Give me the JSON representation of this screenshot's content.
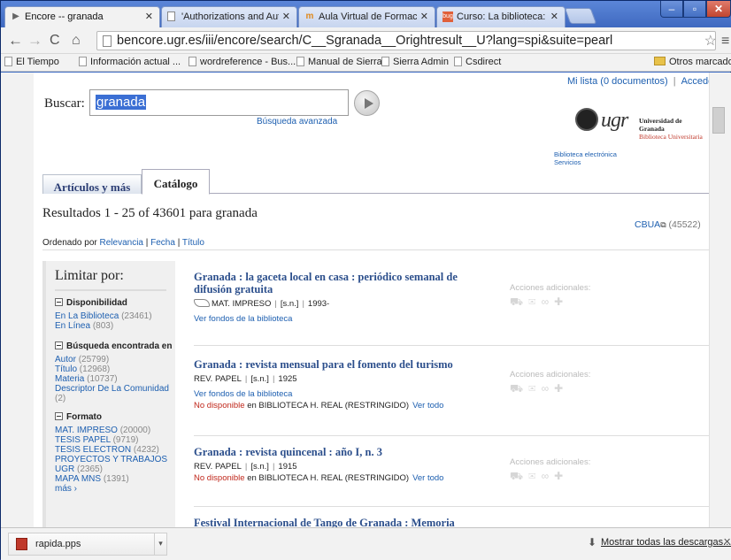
{
  "browser": {
    "tabs": [
      {
        "label": "Encore -- granada",
        "icon": "encore-icon"
      },
      {
        "label": "'Authorizations and Authe",
        "icon": "page-icon"
      },
      {
        "label": "Aula Virtual de Formación",
        "icon": "moodle-icon"
      },
      {
        "label": "Curso: La biblioteca: servic",
        "icon": "bug-icon"
      }
    ],
    "url": "bencore.ugr.es/iii/encore/search/C__Sgranada__Orightresult__U?lang=spi&suite=pearl",
    "bookmarks": [
      "El Tiempo",
      "Información actual ...",
      "wordreference - Bus...",
      "Manual de Sierra",
      "Sierra Admin",
      "Csdirect"
    ],
    "other_bookmarks": "Otros marcadores"
  },
  "page": {
    "top_links": {
      "mylist": "Mi lista (0 documentos)",
      "login": "Acceder"
    },
    "search": {
      "label": "Buscar:",
      "value": "granada",
      "advanced": "Búsqueda avanzada"
    },
    "logo": {
      "text": "ugr",
      "name": "Universidad de Granada",
      "sub": "Biblioteca Universitaria"
    },
    "biblio_links": [
      "Biblioteca electrónica",
      "Servicios"
    ],
    "tabs": [
      "Artículos y más",
      "Catálogo"
    ],
    "results_title": "Resultados 1 - 25 of 43601 para granada",
    "cbua": {
      "label": "CBUA",
      "count": "(45522)"
    },
    "sort": {
      "prefix": "Ordenado por",
      "current": "Relevancia",
      "fecha": "Fecha",
      "titulo": "Título"
    },
    "sidebar": {
      "title": "Limitar por:",
      "groups": [
        {
          "heading": "Disponibilidad",
          "items": [
            {
              "label": "En La Biblioteca",
              "count": "(23461)"
            },
            {
              "label": "En Línea",
              "count": "(803)"
            }
          ]
        },
        {
          "heading": "Búsqueda encontrada en",
          "items": [
            {
              "label": "Autor",
              "count": "(25799)"
            },
            {
              "label": "Título",
              "count": "(12968)"
            },
            {
              "label": "Materia",
              "count": "(10737)"
            },
            {
              "label": "Descriptor De La Comunidad",
              "count": "(2)"
            }
          ]
        },
        {
          "heading": "Formato",
          "items": [
            {
              "label": "MAT. IMPRESO",
              "count": "(20000)"
            },
            {
              "label": "TESIS PAPEL",
              "count": "(9719)"
            },
            {
              "label": "TESIS ELECTRON",
              "count": "(4232)"
            },
            {
              "label": "PROYECTOS Y TRABAJOS UGR",
              "count": "(2365)"
            },
            {
              "label": "MAPA MNS",
              "count": "(1391)"
            }
          ]
        }
      ],
      "more": "más ›"
    },
    "results": [
      {
        "title": "Granada : la gaceta local en casa : periódico semanal de difusión gratuita",
        "type": "MAT. IMPRESO",
        "pub": "[s.n.]",
        "year": "1993-",
        "link": "Ver fondos de la biblioteca"
      },
      {
        "title": "Granada : revista mensual para el fomento del turismo",
        "type": "REV. PAPEL",
        "pub": "[s.n.]",
        "year": "1925",
        "link": "Ver fondos de la biblioteca",
        "avail_no": "No disponible",
        "avail_where": "en BIBLIOTECA H. REAL (RESTRINGIDO)",
        "avail_link": "Ver todo"
      },
      {
        "title": "Granada : revista quincenal : año I, n. 3",
        "type": "REV. PAPEL",
        "pub": "[s.n.]",
        "year": "1915",
        "avail_no": "No disponible",
        "avail_where": "en BIBLIOTECA H. REAL (RESTRINGIDO)",
        "avail_link": "Ver todo"
      },
      {
        "title": "Festival Internacional de Tango de Granada : Memoria"
      }
    ],
    "acciones": "Acciones adicionales:"
  },
  "downloads": {
    "file": "rapida.pps",
    "show_all": "Mostrar todas las descargas..."
  }
}
